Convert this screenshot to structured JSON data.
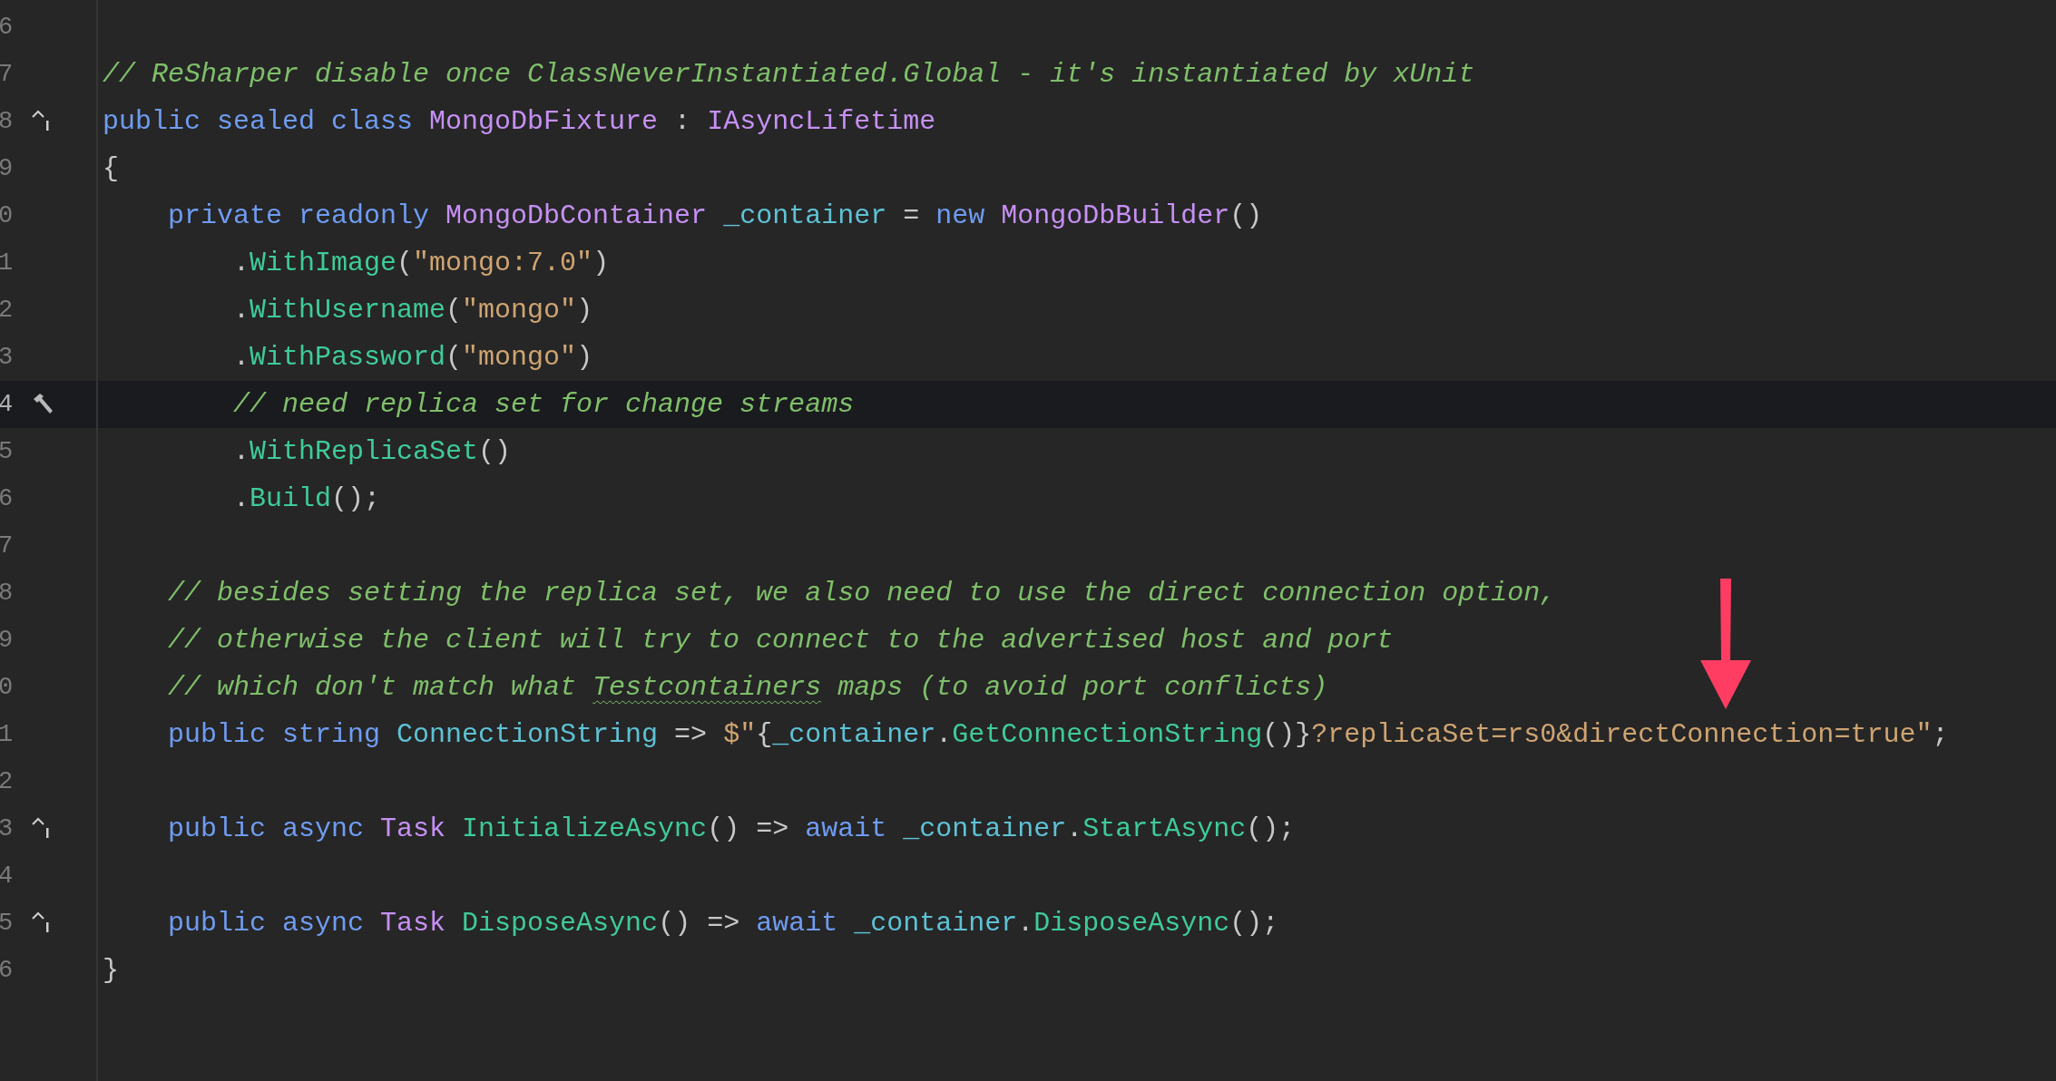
{
  "editor": {
    "lines": [
      {
        "number": "6",
        "kind": "plain",
        "current": false
      },
      {
        "number": "7",
        "kind": "plain",
        "current": false,
        "tokens": [
          {
            "kind": "comment",
            "text": "// ReSharper disable once ClassNeverInstantiated.Global - it's instantiated by xUnit"
          }
        ]
      },
      {
        "number": "8",
        "kind": "implements",
        "current": false,
        "tokens": [
          {
            "kind": "keyword",
            "text": "public sealed class "
          },
          {
            "kind": "type",
            "text": "MongoDbFixture"
          },
          {
            "kind": "plain",
            "text": " : "
          },
          {
            "kind": "type",
            "text": "IAsyncLifetime"
          }
        ]
      },
      {
        "number": "9",
        "kind": "plain",
        "current": false,
        "tokens": [
          {
            "kind": "plain",
            "text": "{"
          }
        ]
      },
      {
        "number": "0",
        "kind": "plain",
        "current": false,
        "tokens": [
          {
            "kind": "keyword",
            "text": "    private readonly "
          },
          {
            "kind": "type",
            "text": "MongoDbContainer "
          },
          {
            "kind": "field",
            "text": "_container"
          },
          {
            "kind": "plain",
            "text": " = "
          },
          {
            "kind": "keyword",
            "text": "new "
          },
          {
            "kind": "type",
            "text": "MongoDbBuilder"
          },
          {
            "kind": "plain",
            "text": "()"
          }
        ]
      },
      {
        "number": "1",
        "kind": "plain",
        "current": false,
        "tokens": [
          {
            "kind": "plain",
            "text": "        ."
          },
          {
            "kind": "method",
            "text": "WithImage"
          },
          {
            "kind": "plain",
            "text": "("
          },
          {
            "kind": "string",
            "text": "\"mongo:7.0\""
          },
          {
            "kind": "plain",
            "text": ")"
          }
        ]
      },
      {
        "number": "2",
        "kind": "plain",
        "current": false,
        "tokens": [
          {
            "kind": "plain",
            "text": "        ."
          },
          {
            "kind": "method",
            "text": "WithUsername"
          },
          {
            "kind": "plain",
            "text": "("
          },
          {
            "kind": "string",
            "text": "\"mongo\""
          },
          {
            "kind": "plain",
            "text": ")"
          }
        ]
      },
      {
        "number": "3",
        "kind": "plain",
        "current": false,
        "tokens": [
          {
            "kind": "plain",
            "text": "        ."
          },
          {
            "kind": "method",
            "text": "WithPassword"
          },
          {
            "kind": "plain",
            "text": "("
          },
          {
            "kind": "string",
            "text": "\"mongo\""
          },
          {
            "kind": "plain",
            "text": ")"
          }
        ]
      },
      {
        "number": "4",
        "kind": "build",
        "current": true,
        "tokens": [
          {
            "kind": "comment",
            "text": "        // need replica set for change streams"
          }
        ]
      },
      {
        "number": "5",
        "kind": "plain",
        "current": false,
        "tokens": [
          {
            "kind": "plain",
            "text": "        ."
          },
          {
            "kind": "method",
            "text": "WithReplicaSet"
          },
          {
            "kind": "plain",
            "text": "()"
          }
        ]
      },
      {
        "number": "6",
        "kind": "plain",
        "current": false,
        "tokens": [
          {
            "kind": "plain",
            "text": "        ."
          },
          {
            "kind": "method",
            "text": "Build"
          },
          {
            "kind": "plain",
            "text": "();"
          }
        ]
      },
      {
        "number": "7",
        "kind": "plain",
        "current": false
      },
      {
        "number": "8",
        "kind": "plain",
        "current": false,
        "tokens": [
          {
            "kind": "comment",
            "text": "    // besides setting the replica set, we also need to use the direct connection option,"
          }
        ]
      },
      {
        "number": "9",
        "kind": "plain",
        "current": false,
        "tokens": [
          {
            "kind": "comment",
            "text": "    // otherwise the client will try to connect to the advertised host and port"
          }
        ]
      },
      {
        "number": "0",
        "kind": "plain",
        "current": false,
        "tokens": [
          {
            "kind": "comment",
            "text": "    // which don't match what "
          },
          {
            "kind": "typo",
            "text": "Testcontainers"
          },
          {
            "kind": "comment",
            "text": " maps (to avoid port conflicts)"
          }
        ]
      },
      {
        "number": "1",
        "kind": "plain",
        "current": false,
        "tokens": [
          {
            "kind": "keyword",
            "text": "    public string "
          },
          {
            "kind": "field",
            "text": "ConnectionString"
          },
          {
            "kind": "plain",
            "text": " => "
          },
          {
            "kind": "string",
            "text": "$\""
          },
          {
            "kind": "plain",
            "text": "{"
          },
          {
            "kind": "field",
            "text": "_container"
          },
          {
            "kind": "plain",
            "text": "."
          },
          {
            "kind": "method",
            "text": "GetConnectionString"
          },
          {
            "kind": "plain",
            "text": "()}"
          },
          {
            "kind": "string",
            "text": "?replicaSet=rs0&directConnection=true\""
          },
          {
            "kind": "plain",
            "text": ";"
          }
        ]
      },
      {
        "number": "2",
        "kind": "plain",
        "current": false
      },
      {
        "number": "3",
        "kind": "implements",
        "current": false,
        "tokens": [
          {
            "kind": "keyword",
            "text": "    public async "
          },
          {
            "kind": "type",
            "text": "Task "
          },
          {
            "kind": "method",
            "text": "InitializeAsync"
          },
          {
            "kind": "plain",
            "text": "() => "
          },
          {
            "kind": "keyword",
            "text": "await "
          },
          {
            "kind": "field",
            "text": "_container"
          },
          {
            "kind": "plain",
            "text": "."
          },
          {
            "kind": "method",
            "text": "StartAsync"
          },
          {
            "kind": "plain",
            "text": "();"
          }
        ]
      },
      {
        "number": "4",
        "kind": "plain",
        "current": false
      },
      {
        "number": "5",
        "kind": "implements",
        "current": false,
        "tokens": [
          {
            "kind": "keyword",
            "text": "    public async "
          },
          {
            "kind": "type",
            "text": "Task "
          },
          {
            "kind": "method",
            "text": "DisposeAsync"
          },
          {
            "kind": "plain",
            "text": "() => "
          },
          {
            "kind": "keyword",
            "text": "await "
          },
          {
            "kind": "field",
            "text": "_container"
          },
          {
            "kind": "plain",
            "text": "."
          },
          {
            "kind": "method",
            "text": "DisposeAsync"
          },
          {
            "kind": "plain",
            "text": "();"
          }
        ]
      },
      {
        "number": "6",
        "kind": "plain",
        "current": false,
        "tokens": [
          {
            "kind": "plain",
            "text": "}"
          }
        ]
      }
    ]
  }
}
